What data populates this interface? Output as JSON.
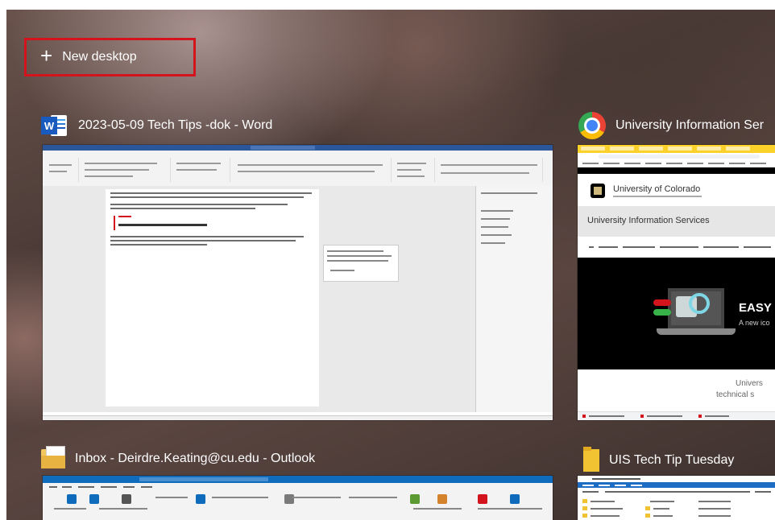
{
  "new_desktop": {
    "icon": "plus-icon",
    "label": "New desktop"
  },
  "windows": [
    {
      "title": "2023-05-09 Tech Tips -dok - Word",
      "icon": "word-icon"
    },
    {
      "title": "University Information Ser",
      "icon": "chrome-icon"
    },
    {
      "title": "Inbox - Deirdre.Keating@cu.edu - Outlook",
      "icon": "outlook-icon"
    },
    {
      "title": "UIS Tech Tip Tuesday",
      "icon": "folder-icon"
    }
  ],
  "browser_page": {
    "university_name": "University of Colorado",
    "banner": "University Information Services",
    "hero_heading": "EASY",
    "hero_sub": "A new ico",
    "lower_line1": "Univers",
    "lower_line2": "technical s"
  },
  "colors": {
    "highlight_border": "#d4141c",
    "word_blue": "#2b579a",
    "chrome_tab_yellow": "#fcd12a",
    "outlook_blue": "#0f6cbd"
  }
}
